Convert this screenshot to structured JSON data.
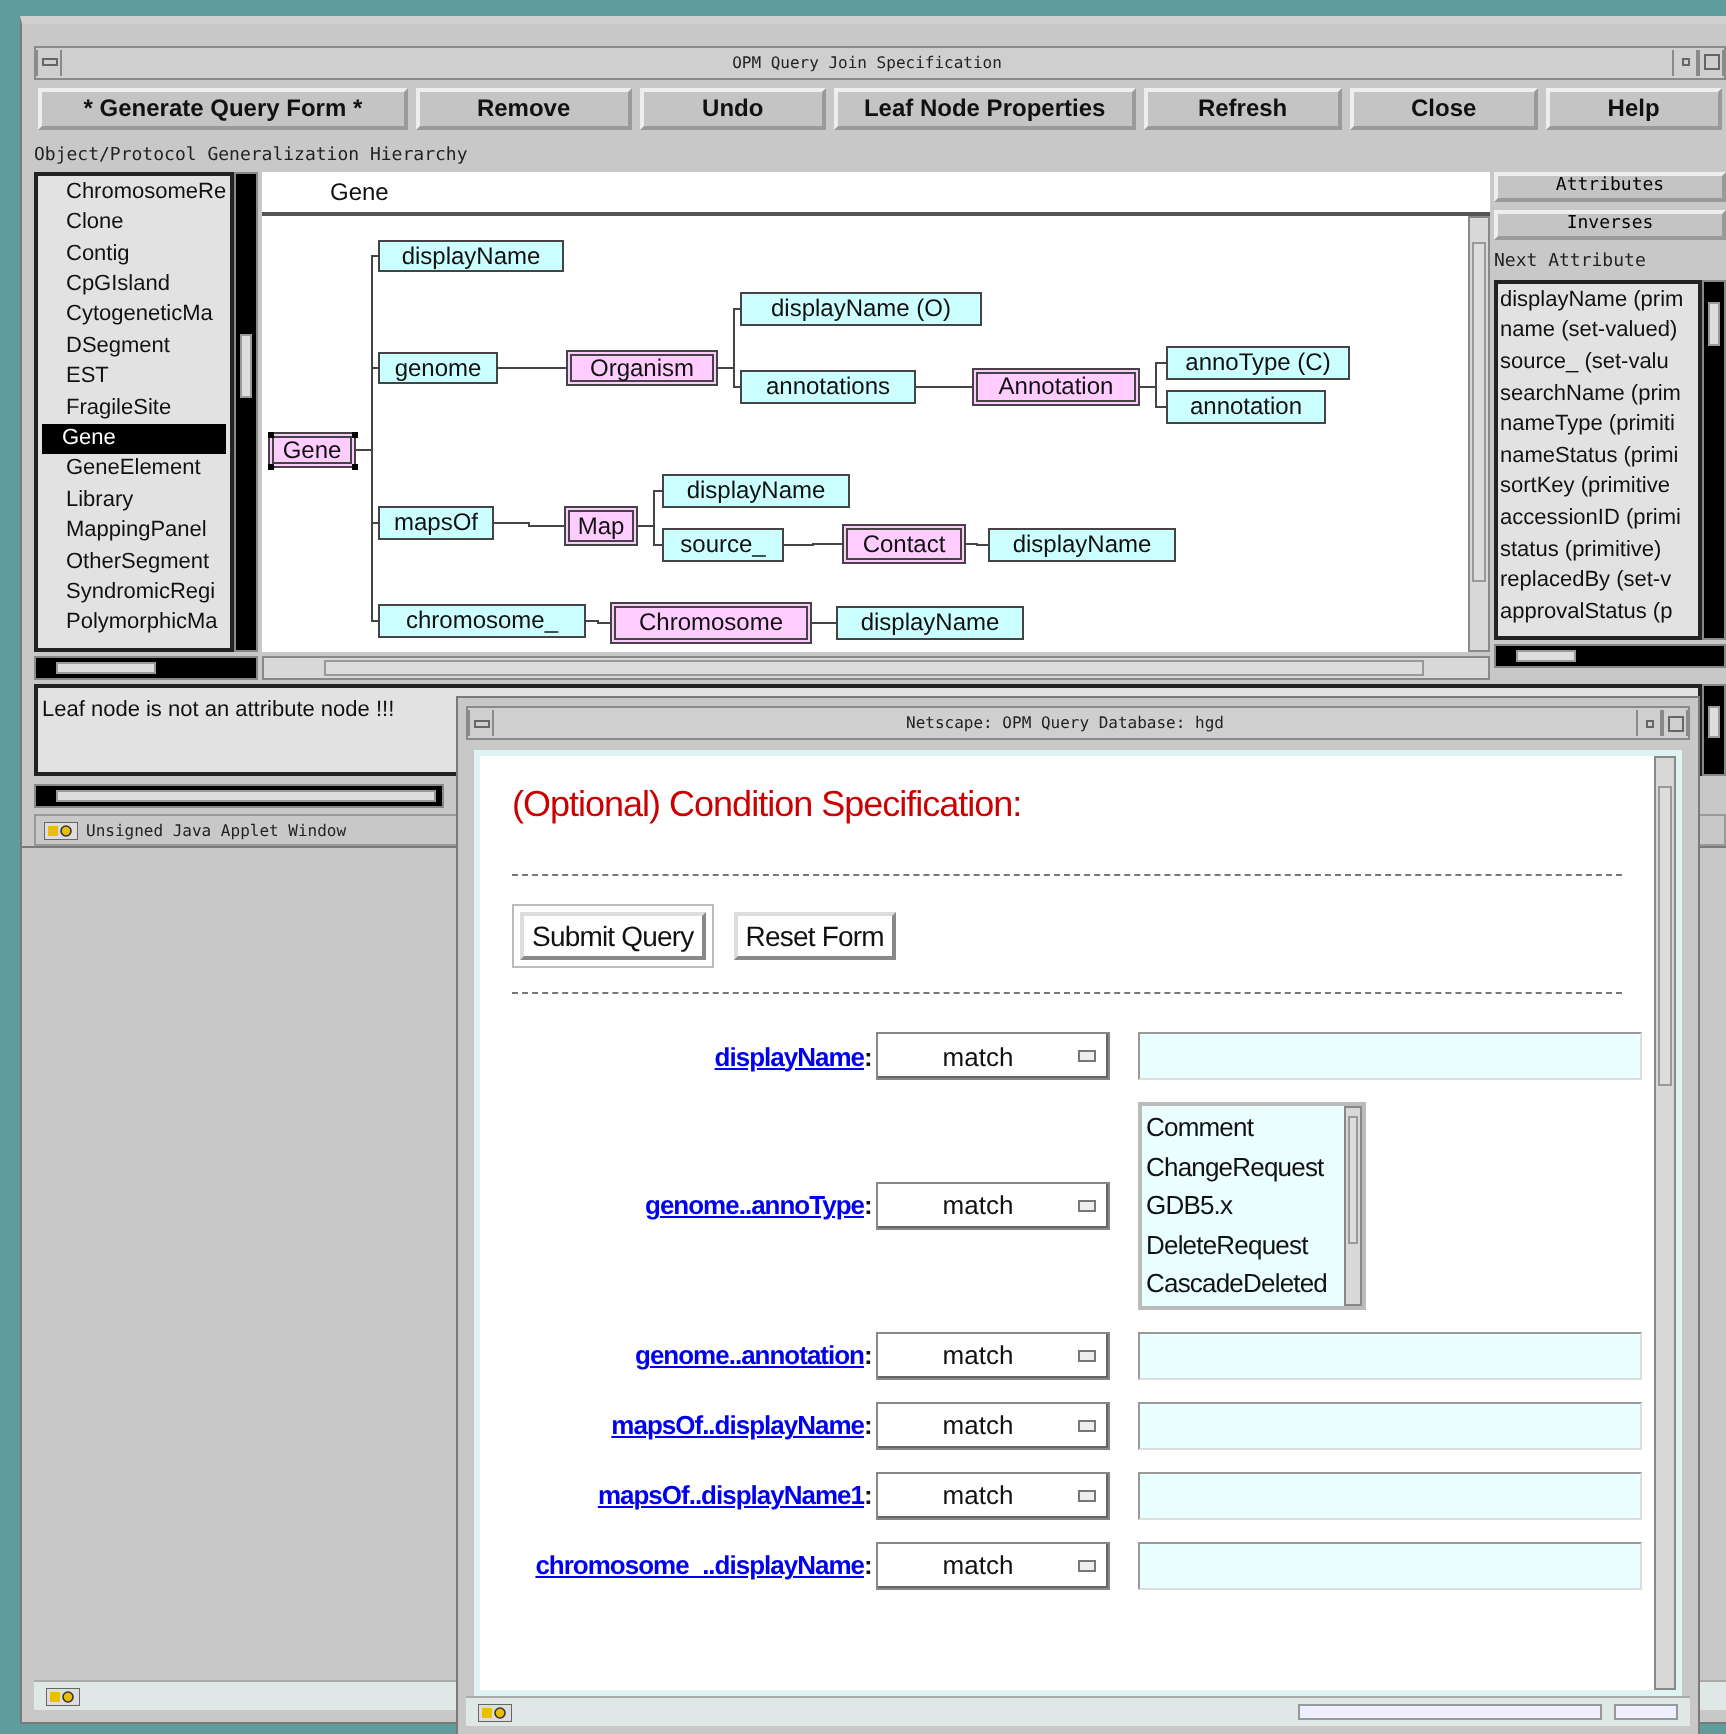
{
  "main_window": {
    "title": "OPM Query Join Specification",
    "toolbar": [
      "* Generate Query Form *",
      "Remove",
      "Undo",
      "Leaf Node Properties",
      "Refresh",
      "Close",
      "Help"
    ],
    "hierarchy_label": "Object/Protocol Generalization Hierarchy",
    "class_list": [
      {
        "label": "ChromosomeRe",
        "selected": false
      },
      {
        "label": "Clone",
        "selected": false
      },
      {
        "label": "Contig",
        "selected": false
      },
      {
        "label": "CpGIsland",
        "selected": false
      },
      {
        "label": "CytogeneticMa",
        "selected": false
      },
      {
        "label": "DSegment",
        "selected": false
      },
      {
        "label": "EST",
        "selected": false
      },
      {
        "label": "FragileSite",
        "selected": false
      },
      {
        "label": "Gene",
        "selected": true
      },
      {
        "label": "GeneElement",
        "selected": false
      },
      {
        "label": "Library",
        "selected": false
      },
      {
        "label": "MappingPanel",
        "selected": false
      },
      {
        "label": "OtherSegment",
        "selected": false
      },
      {
        "label": "SyndromicRegi",
        "selected": false
      },
      {
        "label": "PolymorphicMa",
        "selected": false
      }
    ],
    "diagram": {
      "header": "Gene",
      "tree": {
        "label": "Gene",
        "kind": "class",
        "selected": true,
        "children": [
          {
            "label": "displayName",
            "kind": "attribute",
            "selected": false
          },
          {
            "label": "genome",
            "kind": "attribute",
            "selected": false,
            "children": [
              {
                "label": "Organism",
                "kind": "class",
                "selected": false,
                "children": [
                  {
                    "label": "displayName (O)",
                    "kind": "attribute",
                    "selected": false
                  },
                  {
                    "label": "annotations",
                    "kind": "attribute",
                    "selected": false,
                    "children": [
                      {
                        "label": "Annotation",
                        "kind": "class",
                        "selected": false,
                        "children": [
                          {
                            "label": "annoType (C)",
                            "kind": "attribute",
                            "selected": false
                          },
                          {
                            "label": "annotation",
                            "kind": "attribute",
                            "selected": false
                          }
                        ]
                      }
                    ]
                  }
                ]
              }
            ]
          },
          {
            "label": "mapsOf",
            "kind": "attribute",
            "selected": false,
            "children": [
              {
                "label": "Map",
                "kind": "class",
                "selected": false,
                "children": [
                  {
                    "label": "displayName",
                    "kind": "attribute",
                    "selected": false
                  },
                  {
                    "label": "source_",
                    "kind": "attribute",
                    "selected": false,
                    "children": [
                      {
                        "label": "Contact",
                        "kind": "class",
                        "selected": false,
                        "children": [
                          {
                            "label": "displayName",
                            "kind": "attribute",
                            "selected": false
                          }
                        ]
                      }
                    ]
                  }
                ]
              }
            ]
          },
          {
            "label": "chromosome_",
            "kind": "attribute",
            "selected": false,
            "children": [
              {
                "label": "Chromosome",
                "kind": "class",
                "selected": false,
                "children": [
                  {
                    "label": "displayName",
                    "kind": "attribute",
                    "selected": false
                  }
                ]
              }
            ]
          }
        ]
      }
    },
    "side_buttons": [
      "Attributes",
      "Inverses"
    ],
    "next_attribute_label": "Next Attribute",
    "attribute_list": [
      "displayName (prim",
      "name (set-valued)",
      "source_ (set-valu",
      "searchName (prim",
      "nameType (primiti",
      "nameStatus (primi",
      "sortKey (primitive",
      "accessionID (primi",
      "status (primitive)",
      "replacedBy (set-v",
      "approvalStatus (p"
    ],
    "message": "Leaf node is not an attribute node !!!",
    "status": "Unsigned Java Applet Window"
  },
  "browser_window": {
    "title": "Netscape: OPM Query Database: hgd",
    "heading": "(Optional) Condition Specification:",
    "buttons": [
      {
        "label": "Submit Query",
        "default": true
      },
      {
        "label": "Reset Form",
        "default": false
      }
    ],
    "conditions": [
      {
        "label": "displayName",
        "suffix": ":",
        "operator": "match",
        "kind": "text"
      },
      {
        "label": "genome..annoType",
        "suffix": ":",
        "operator": "match",
        "kind": "list",
        "options": [
          "Comment",
          "ChangeRequest",
          "GDB5.x",
          "DeleteRequest",
          "CascadeDeleted"
        ]
      },
      {
        "label": "genome..annotation",
        "suffix": ":",
        "operator": "match",
        "kind": "text"
      },
      {
        "label": "mapsOf..displayName",
        "suffix": ":",
        "operator": "match",
        "kind": "text"
      },
      {
        "label": "mapsOf..displayName1",
        "suffix": ":",
        "operator": "match",
        "kind": "text"
      },
      {
        "label": "chromosome_..displayName",
        "suffix": ":",
        "operator": "match",
        "kind": "text"
      }
    ]
  }
}
